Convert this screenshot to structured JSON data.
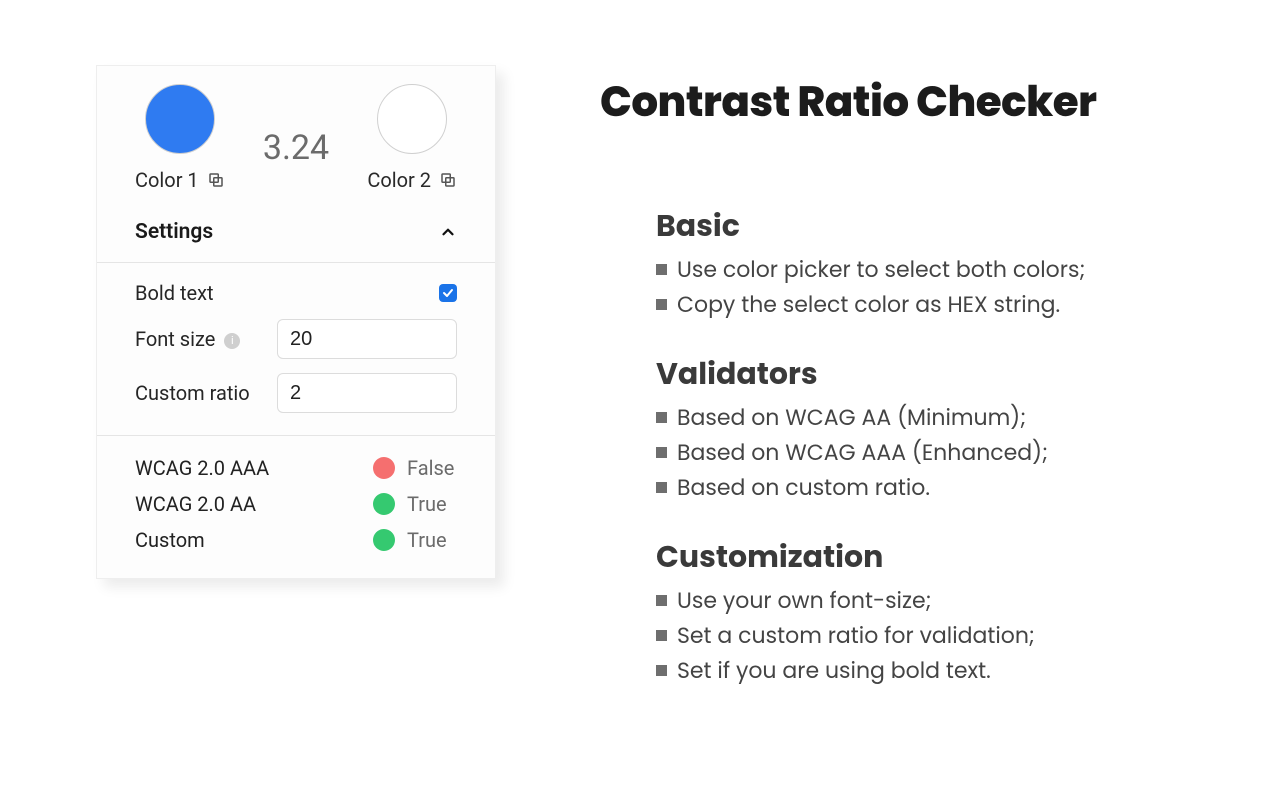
{
  "title": "Contrast Ratio Checker",
  "panel": {
    "color1": {
      "label": "Color 1",
      "hex": "#2f7bf1"
    },
    "color2": {
      "label": "Color 2",
      "hex": "#ffffff"
    },
    "ratio": "3.24",
    "settings_label": "Settings",
    "settings": {
      "bold_text": {
        "label": "Bold text",
        "checked": true
      },
      "font_size": {
        "label": "Font size",
        "value": "20"
      },
      "custom_ratio": {
        "label": "Custom ratio",
        "value": "2"
      }
    },
    "results": [
      {
        "label": "WCAG 2.0 AAA",
        "pass": false,
        "text": "False",
        "color": "#f56f6f"
      },
      {
        "label": "WCAG 2.0 AA",
        "pass": true,
        "text": "True",
        "color": "#35c970"
      },
      {
        "label": "Custom",
        "pass": true,
        "text": "True",
        "color": "#35c970"
      }
    ]
  },
  "sections": [
    {
      "head": "Basic",
      "items": [
        "Use color picker to select both colors;",
        "Copy the select color as HEX string."
      ]
    },
    {
      "head": "Validators",
      "items": [
        "Based on WCAG AA (Minimum);",
        "Based on WCAG AAA (Enhanced);",
        "Based on custom ratio."
      ]
    },
    {
      "head": "Customization",
      "items": [
        "Use your own font-size;",
        "Set a custom ratio for validation;",
        "Set if you are using bold text."
      ]
    }
  ]
}
